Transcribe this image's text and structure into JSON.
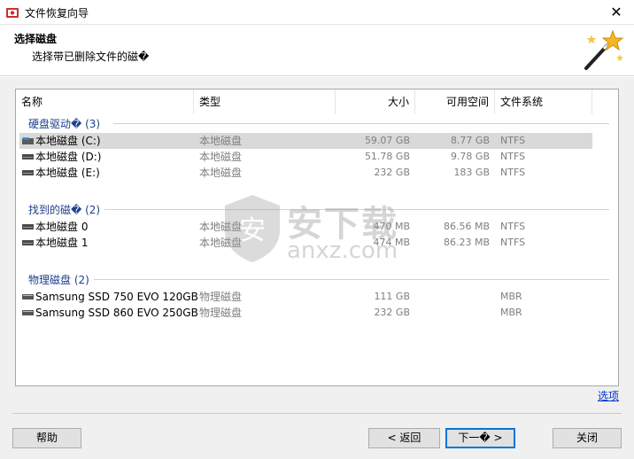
{
  "window": {
    "title": "文件恢复向导",
    "close_glyph": "✕"
  },
  "header": {
    "title": "选择磁盘",
    "subtitle": "选择带已删除文件的磁�"
  },
  "columns": {
    "name": "名称",
    "type": "类型",
    "size": "大小",
    "free": "可用空间",
    "fs": "文件系统"
  },
  "groups": [
    {
      "title": "硬盘驱动� (3)",
      "rows": [
        {
          "name": "本地磁盘 (C:)",
          "type": "本地磁盘",
          "size": "59.07 GB",
          "free": "8.77 GB",
          "fs": "NTFS",
          "icon": "windows-drive-icon",
          "selected": true
        },
        {
          "name": "本地磁盘 (D:)",
          "type": "本地磁盘",
          "size": "51.78 GB",
          "free": "9.78 GB",
          "fs": "NTFS",
          "icon": "drive-icon"
        },
        {
          "name": "本地磁盘 (E:)",
          "type": "本地磁盘",
          "size": "232 GB",
          "free": "183 GB",
          "fs": "NTFS",
          "icon": "drive-icon"
        }
      ]
    },
    {
      "title": "找到的磁� (2)",
      "rows": [
        {
          "name": "本地磁盘 0",
          "type": "本地磁盘",
          "size": "470 MB",
          "free": "86.56 MB",
          "fs": "NTFS",
          "icon": "drive-icon"
        },
        {
          "name": "本地磁盘 1",
          "type": "本地磁盘",
          "size": "474 MB",
          "free": "86.23 MB",
          "fs": "NTFS",
          "icon": "drive-icon"
        }
      ]
    },
    {
      "title": "物理磁盘 (2)",
      "rows": [
        {
          "name": "Samsung SSD 750 EVO 120GB",
          "type": "物理磁盘",
          "size": "111 GB",
          "free": "",
          "fs": "MBR",
          "icon": "physical-disk-icon"
        },
        {
          "name": "Samsung SSD 860 EVO 250GB",
          "type": "物理磁盘",
          "size": "232 GB",
          "free": "",
          "fs": "MBR",
          "icon": "physical-disk-icon"
        }
      ]
    }
  ],
  "watermark": {
    "text": "安下载",
    "url": "anxz.com"
  },
  "options_link": "选项",
  "buttons": {
    "help": "帮助",
    "back": "< 返回",
    "next": "下一� >",
    "close": "关闭"
  },
  "colors": {
    "accent": "#0078d7",
    "group_title": "#1e3f8c",
    "selected_row": "#d9d9d9",
    "link": "#0033cc"
  }
}
